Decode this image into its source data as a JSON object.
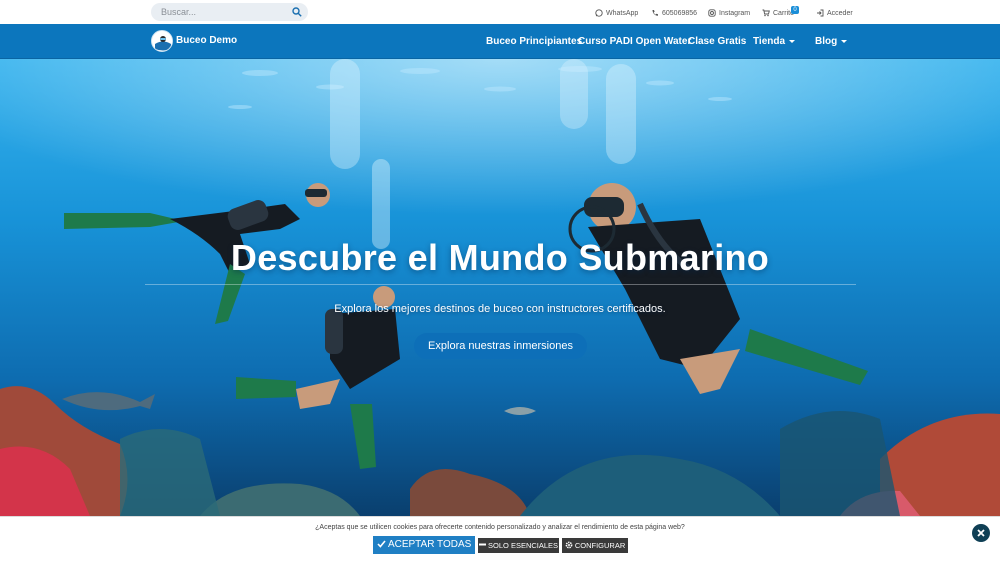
{
  "topbar": {
    "search_placeholder": "Buscar...",
    "whatsapp": "WhatsApp",
    "phone": "605069856",
    "instagram": "Instagram",
    "cart": "Carrito",
    "cart_count": "0",
    "login": "Acceder"
  },
  "nav": {
    "brand": "Buceo Demo",
    "items": [
      {
        "label": "Buceo Principiantes"
      },
      {
        "label": "Curso PADI Open Water"
      },
      {
        "label": "Clase Gratis"
      },
      {
        "label": "Tienda"
      },
      {
        "label": "Blog"
      }
    ]
  },
  "hero": {
    "title": "Descubre el Mundo Submarino",
    "subtitle": "Explora los mejores destinos de buceo con instructores certificados.",
    "cta": "Explora nuestras inmersiones"
  },
  "cookie": {
    "text": "¿Aceptas que se utilicen cookies para ofrecerte contenido personalizado y analizar el rendimiento de esta página web?",
    "accept": "ACEPTAR TODAS",
    "essential": "SOLO ESENCIALES",
    "configure": "CONFIGURAR"
  },
  "colors": {
    "nav": "#0c76bd",
    "accent": "#1f7fc4",
    "ocean_top": "#2ea6e6",
    "ocean_bottom": "#0a3f6e"
  },
  "icons": [
    "search-icon",
    "whatsapp-icon",
    "phone-icon",
    "instagram-icon",
    "cart-icon",
    "login-icon",
    "check-icon",
    "minus-icon",
    "gear-icon",
    "close-icon"
  ]
}
